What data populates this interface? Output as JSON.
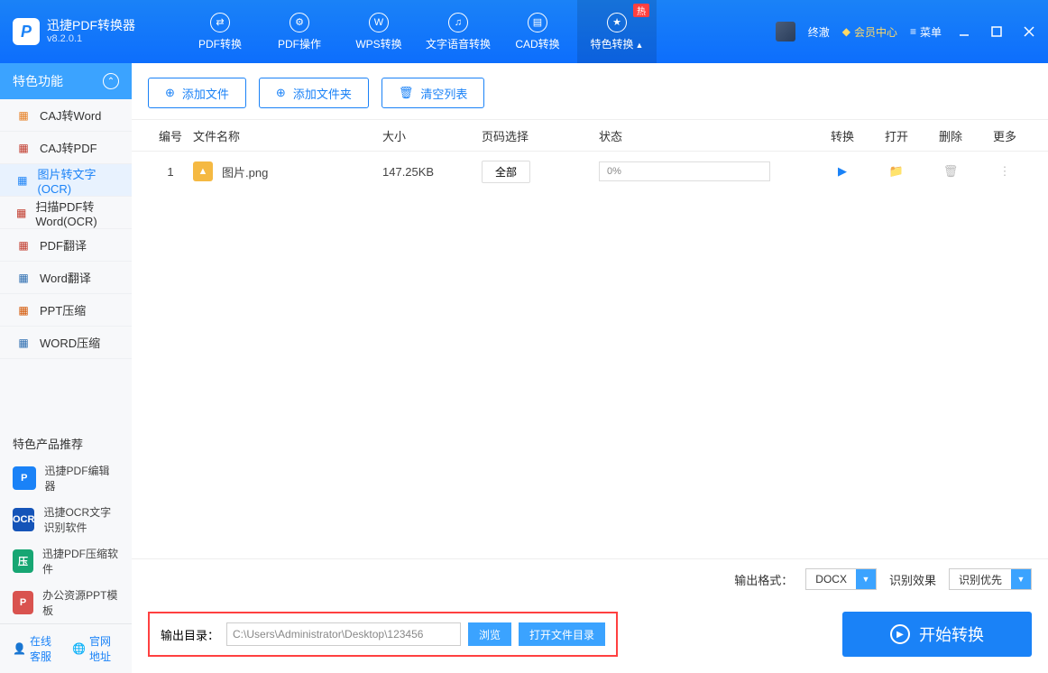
{
  "app": {
    "title": "迅捷PDF转换器",
    "version": "v8.2.0.1"
  },
  "tabs": [
    {
      "label": "PDF转换"
    },
    {
      "label": "PDF操作"
    },
    {
      "label": "WPS转换"
    },
    {
      "label": "文字语音转换"
    },
    {
      "label": "CAD转换"
    },
    {
      "label": "特色转换",
      "active": true,
      "badge": "热"
    }
  ],
  "user": {
    "name": "终澈",
    "vip": "会员中心",
    "menu": "菜单"
  },
  "sidebar": {
    "header": "特色功能",
    "items": [
      {
        "label": "CAJ转Word",
        "color": "#e67e22"
      },
      {
        "label": "CAJ转PDF",
        "color": "#c0392b"
      },
      {
        "label": "图片转文字(OCR)",
        "color": "#1a82f7",
        "active": true
      },
      {
        "label": "扫描PDF转Word(OCR)",
        "color": "#c0392b"
      },
      {
        "label": "PDF翻译",
        "color": "#c0392b"
      },
      {
        "label": "Word翻译",
        "color": "#2b6cb0"
      },
      {
        "label": "PPT压缩",
        "color": "#d35400"
      },
      {
        "label": "WORD压缩",
        "color": "#2b6cb0"
      }
    ],
    "promo_title": "特色产品推荐",
    "promos": [
      {
        "label": "迅捷PDF编辑器",
        "bg": "#1a82f7",
        "ab": "P"
      },
      {
        "label": "迅捷OCR文字识别软件",
        "bg": "#1554b8",
        "ab": "OCR"
      },
      {
        "label": "迅捷PDF压缩软件",
        "bg": "#17a673",
        "ab": "压"
      },
      {
        "label": "办公资源PPT模板",
        "bg": "#d9534f",
        "ab": "P"
      }
    ],
    "footer": {
      "cs": "在线客服",
      "site": "官网地址"
    }
  },
  "toolbar": {
    "add_file": "添加文件",
    "add_folder": "添加文件夹",
    "clear": "清空列表"
  },
  "table": {
    "headers": {
      "num": "编号",
      "name": "文件名称",
      "size": "大小",
      "page": "页码选择",
      "status": "状态",
      "convert": "转换",
      "open": "打开",
      "delete": "删除",
      "more": "更多"
    },
    "rows": [
      {
        "num": "1",
        "name": "图片.png",
        "size": "147.25KB",
        "page_btn": "全部",
        "progress": "0%"
      }
    ]
  },
  "output": {
    "format_label": "输出格式：",
    "format_value": "DOCX",
    "effect_label": "识别效果",
    "effect_value": "识别优先",
    "dir_label": "输出目录：",
    "dir_value": "C:\\Users\\Administrator\\Desktop\\123456",
    "browse": "浏览",
    "open_dir": "打开文件目录",
    "start": "开始转换"
  }
}
